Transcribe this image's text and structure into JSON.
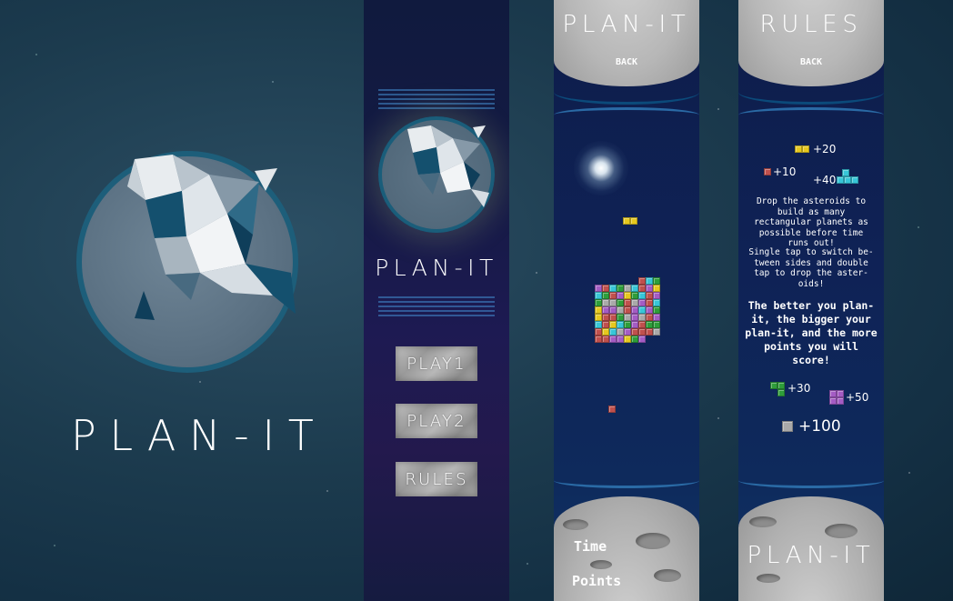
{
  "app": {
    "logo_text": "PLAN-IT",
    "colors": {
      "background": "#1c3b4e",
      "planet": "#5b7183",
      "planet_ring": "#1d5e7a",
      "menu_panel": "#141a44",
      "game_panel": "#0f2256",
      "moon": "#b7b7b7"
    }
  },
  "menu": {
    "logo_text": "PLAN-IT",
    "buttons": [
      {
        "label": "PLAY1"
      },
      {
        "label": "PLAY2"
      },
      {
        "label": "RULES"
      }
    ]
  },
  "game": {
    "header_title": "PLAN-IT",
    "back_label": "BACK",
    "time_label": "Time",
    "points_label": "Points"
  },
  "rules": {
    "header_title": "RULES",
    "back_label": "BACK",
    "footer_logo": "PLAN-IT",
    "paragraph1": "Drop the asteroids to build as many rectangular planets as possible before time runs out!",
    "paragraph2": "Single tap to switch be- tween sides and double tap to drop the aster- oids!",
    "emphasis": "The better you plan-it, the bigger your plan-it, and the more points you will score!",
    "scores": {
      "yellow": "+20",
      "red": "+10",
      "cyan": "+40",
      "green": "+30",
      "purple": "+50",
      "grey": "+100"
    }
  }
}
